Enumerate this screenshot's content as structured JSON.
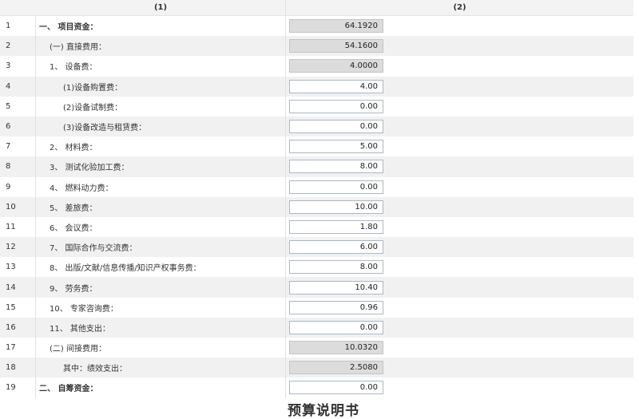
{
  "header": {
    "col1": "(1)",
    "col2": "(2)"
  },
  "rows": [
    {
      "num": "1",
      "label": "一、 项目资金：",
      "value": "64.1920"
    },
    {
      "num": "2",
      "label": "(一) 直接费用：",
      "value": "54.1600"
    },
    {
      "num": "3",
      "label": "1、 设备费：",
      "value": "4.0000"
    },
    {
      "num": "4",
      "label": "(1)设备购置费：",
      "value": "4.00"
    },
    {
      "num": "5",
      "label": "(2)设备试制费：",
      "value": "0.00"
    },
    {
      "num": "6",
      "label": "(3)设备改造与租赁费：",
      "value": "0.00"
    },
    {
      "num": "7",
      "label": "2、 材料费：",
      "value": "5.00"
    },
    {
      "num": "8",
      "label": "3、 测试化验加工费：",
      "value": "8.00"
    },
    {
      "num": "9",
      "label": "4、 燃料动力费：",
      "value": "0.00"
    },
    {
      "num": "10",
      "label": "5、 差旅费：",
      "value": "10.00"
    },
    {
      "num": "11",
      "label": "6、 会议费：",
      "value": "1.80"
    },
    {
      "num": "12",
      "label": "7、 国际合作与交流费：",
      "value": "6.00"
    },
    {
      "num": "13",
      "label": "8、 出版/文献/信息传播/知识产权事务费：",
      "value": "8.00"
    },
    {
      "num": "14",
      "label": "9、 劳务费：",
      "value": "10.40"
    },
    {
      "num": "15",
      "label": "10、 专家咨询费：",
      "value": "0.96"
    },
    {
      "num": "16",
      "label": "11、 其他支出：",
      "value": "0.00"
    },
    {
      "num": "17",
      "label": "(二) 间接费用：",
      "value": "10.0320"
    },
    {
      "num": "18",
      "label": "其中：绩效支出：",
      "value": "2.5080"
    },
    {
      "num": "19",
      "label": "二、 自筹资金：",
      "value": "0.00"
    }
  ],
  "footer": {
    "title": "预算说明书"
  }
}
